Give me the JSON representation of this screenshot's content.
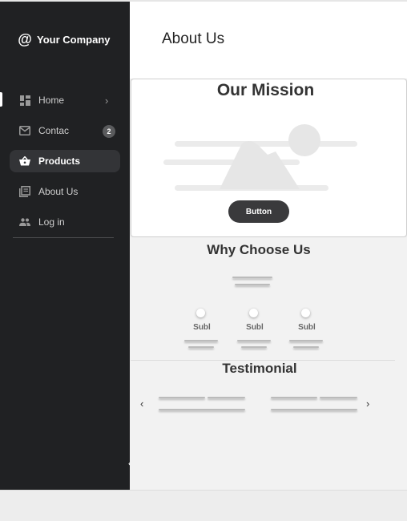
{
  "brand": {
    "name": "Your Company",
    "icon": "at-icon"
  },
  "sidebar": {
    "items": [
      {
        "label": "Home",
        "icon": "dashboard-icon"
      },
      {
        "label": "Contac",
        "icon": "mail-icon",
        "badge": "2"
      },
      {
        "label": "Products",
        "icon": "basket-icon"
      },
      {
        "label": "About Us",
        "icon": "library-icon"
      },
      {
        "label": "Log in",
        "icon": "people-icon"
      }
    ]
  },
  "header": {
    "title": "About Us"
  },
  "mission": {
    "title": "Our Mission",
    "button_label": "Button"
  },
  "why": {
    "title": "Why Choose Us",
    "features": [
      {
        "label": "Subl"
      },
      {
        "label": "Subl"
      },
      {
        "label": "Subl"
      }
    ]
  },
  "testimonial": {
    "title": "Testimonial",
    "prev": "‹",
    "next": "›"
  },
  "colors": {
    "sidebar_bg": "#202123",
    "selected_bg": "#333437",
    "button_bg": "#3a3a3c",
    "content_bg": "#f2f2f2"
  }
}
